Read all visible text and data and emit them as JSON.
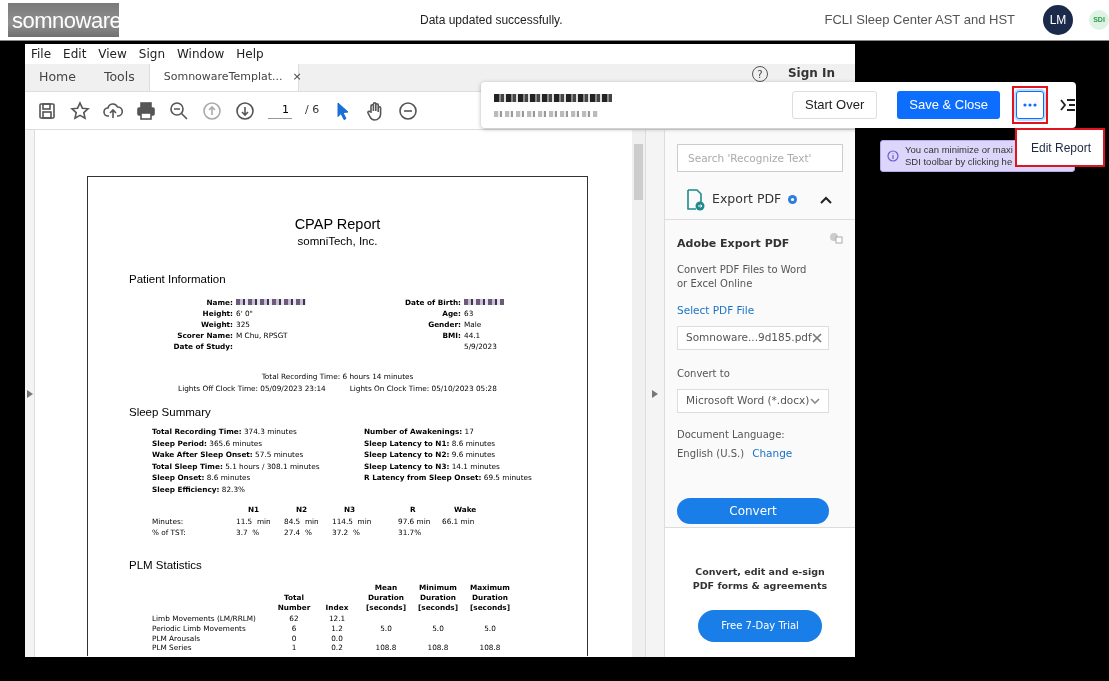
{
  "app_header": {
    "logo": "somnoware",
    "message": "Data updated successfully.",
    "facility": "FCLI Sleep Center AST and HST",
    "avatar": "LM",
    "badge": "SDI"
  },
  "acrobat": {
    "menu": [
      "File",
      "Edit",
      "View",
      "Sign",
      "Window",
      "Help"
    ],
    "tabs": [
      {
        "label": "Home",
        "selected": false
      },
      {
        "label": "Tools",
        "selected": false
      },
      {
        "label": "SomnowareTemplat...",
        "selected": true,
        "close": "×"
      }
    ],
    "help": "?",
    "sign_in": "Sign In",
    "page_number": "1",
    "page_total": "/ 6"
  },
  "report": {
    "title": "CPAP Report",
    "company": "somniTech, Inc.",
    "patient_heading": "Patient Information",
    "patient_rows": [
      {
        "left_label": "Name:",
        "left_redacted": true,
        "right_label": "Date of Birth:",
        "right_redacted": true
      },
      {
        "left_label": "Height:",
        "left_value": "6' 0\"",
        "right_label": "Age:",
        "right_value": "63"
      },
      {
        "left_label": "Weight:",
        "left_value": "325",
        "right_label": "Gender:",
        "right_value": "Male"
      },
      {
        "left_label": "Scorer Name:",
        "left_value": "M Chu, RPSGT",
        "right_label": "BMI:",
        "right_value": "44.1"
      },
      {
        "left_label": "Date of Study:",
        "right_value": "5/9/2023"
      }
    ],
    "total_recording": "Total Recording Time: 6 hours 14 minutes",
    "lights_off": "Lights Off Clock Time: 05/09/2023 23:14",
    "lights_on": "Lights On Clock Time: 05/10/2023 05:28",
    "summary_heading": "Sleep Summary",
    "summary_left": [
      "**Total Recording Time:** 374.3 minutes",
      "**Sleep Period:** 365.6 minutes",
      "**Wake After Sleep Onset:** 57.5 minutes",
      "**Total Sleep Time:** 5.1 hours / 308.1 minutes",
      "**Sleep Onset:** 8.6 minutes",
      "**Sleep Efficiency:** 82.3%"
    ],
    "summary_right": [
      "**Number of Awakenings:** 17",
      "**Sleep Latency to N1:** 8.6 minutes",
      "**Sleep Latency to N2:** 9.6 minutes",
      "**Sleep Latency to N3:** 14.1 minutes",
      "**R Latency from Sleep Onset:** 69.5 minutes"
    ],
    "stage_columns": [
      "N1",
      "N2",
      "N3",
      "R",
      "Wake"
    ],
    "stage_rows": [
      {
        "label": "Minutes:",
        "cells": [
          "11.5  min",
          "84.5  min",
          "114.5  min",
          "97.6 min",
          "66.1 min"
        ]
      },
      {
        "label": "% of TST:",
        "cells": [
          "3.7  %",
          "27.4  %",
          "37.2  %",
          "31.7%",
          ""
        ]
      }
    ],
    "plm_heading": "PLM Statistics",
    "plm_columns": [
      "Total Number",
      "Index",
      "Mean Duration [seconds]",
      "Minimum Duration [seconds]",
      "Maximum Duration [seconds]"
    ],
    "plm_rows": [
      {
        "label": "Limb Movements (LM/RRLM)",
        "cells": [
          "62",
          "12.1",
          "",
          "",
          ""
        ]
      },
      {
        "label": "Periodic Limb Movements",
        "cells": [
          "6",
          "1.2",
          "5.0",
          "5.0",
          "5.0"
        ]
      },
      {
        "label": "PLM Arousals",
        "cells": [
          "0",
          "0.0",
          "",
          "",
          ""
        ]
      },
      {
        "label": "PLM Series",
        "cells": [
          "1",
          "0.2",
          "108.8",
          "108.8",
          "108.8"
        ]
      }
    ]
  },
  "side_panel": {
    "search_placeholder": "Search 'Recognize Text'",
    "tool_title": "Export PDF",
    "expanded": true,
    "section_title": "Adobe Export PDF",
    "description": "Convert PDF Files to Word or Excel Online",
    "select_link": "Select PDF File",
    "file_name": "Somnoware...9d185.pdf",
    "convert_to_label": "Convert to",
    "format": "Microsoft Word (*.docx)",
    "language_label": "Document Language:",
    "language": "English (U.S.)",
    "change_link": "Change",
    "convert_button": "Convert",
    "promo": "Convert, edit and e-sign PDF forms & agreements",
    "trial_button": "Free 7-Day Trial"
  },
  "sdi_toolbar": {
    "title_redacted": true,
    "start_over": "Start Over",
    "save_close": "Save & Close",
    "menu_open": true
  },
  "tooltip": {
    "lines": [
      "You can minimize or maxi",
      "SDI toolbar by clicking he"
    ]
  },
  "dropdown": {
    "items": [
      "Edit Report"
    ]
  }
}
